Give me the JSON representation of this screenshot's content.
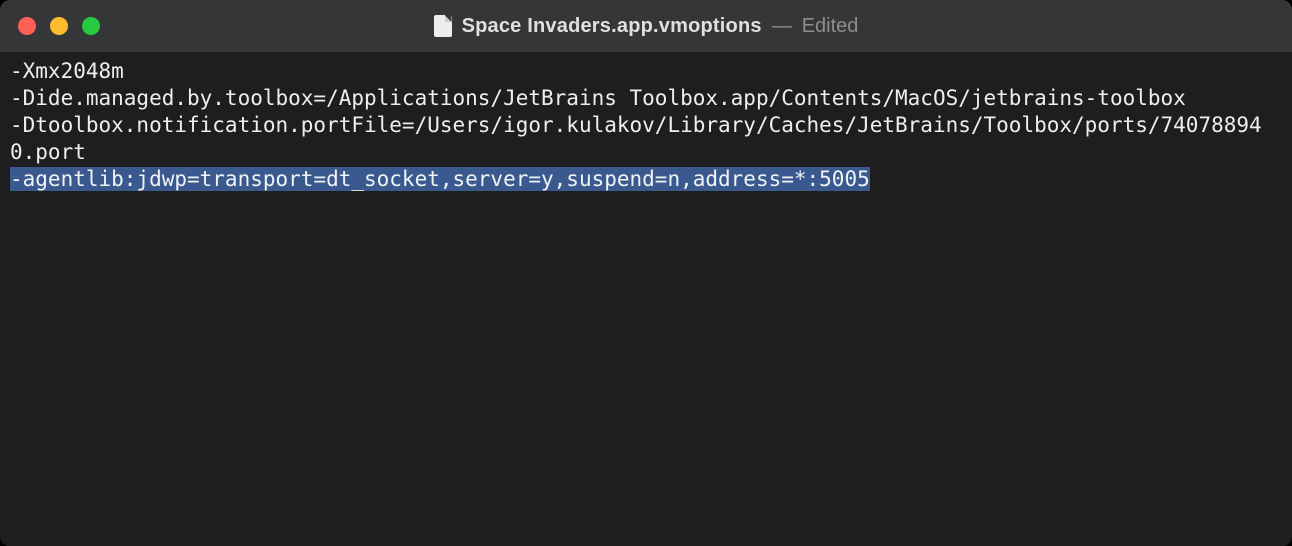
{
  "titlebar": {
    "filename": "Space Invaders.app.vmoptions",
    "separator": "—",
    "status": "Edited"
  },
  "editor": {
    "lines": [
      "-Xmx2048m",
      "-Dide.managed.by.toolbox=/Applications/JetBrains Toolbox.app/Contents/MacOS/jetbrains-toolbox",
      "-Dtoolbox.notification.portFile=/Users/igor.kulakov/Library/Caches/JetBrains/Toolbox/ports/740788940.port"
    ],
    "selected_line": "-agentlib:jdwp=transport=dt_socket,server=y,suspend=n,address=*:5005"
  }
}
